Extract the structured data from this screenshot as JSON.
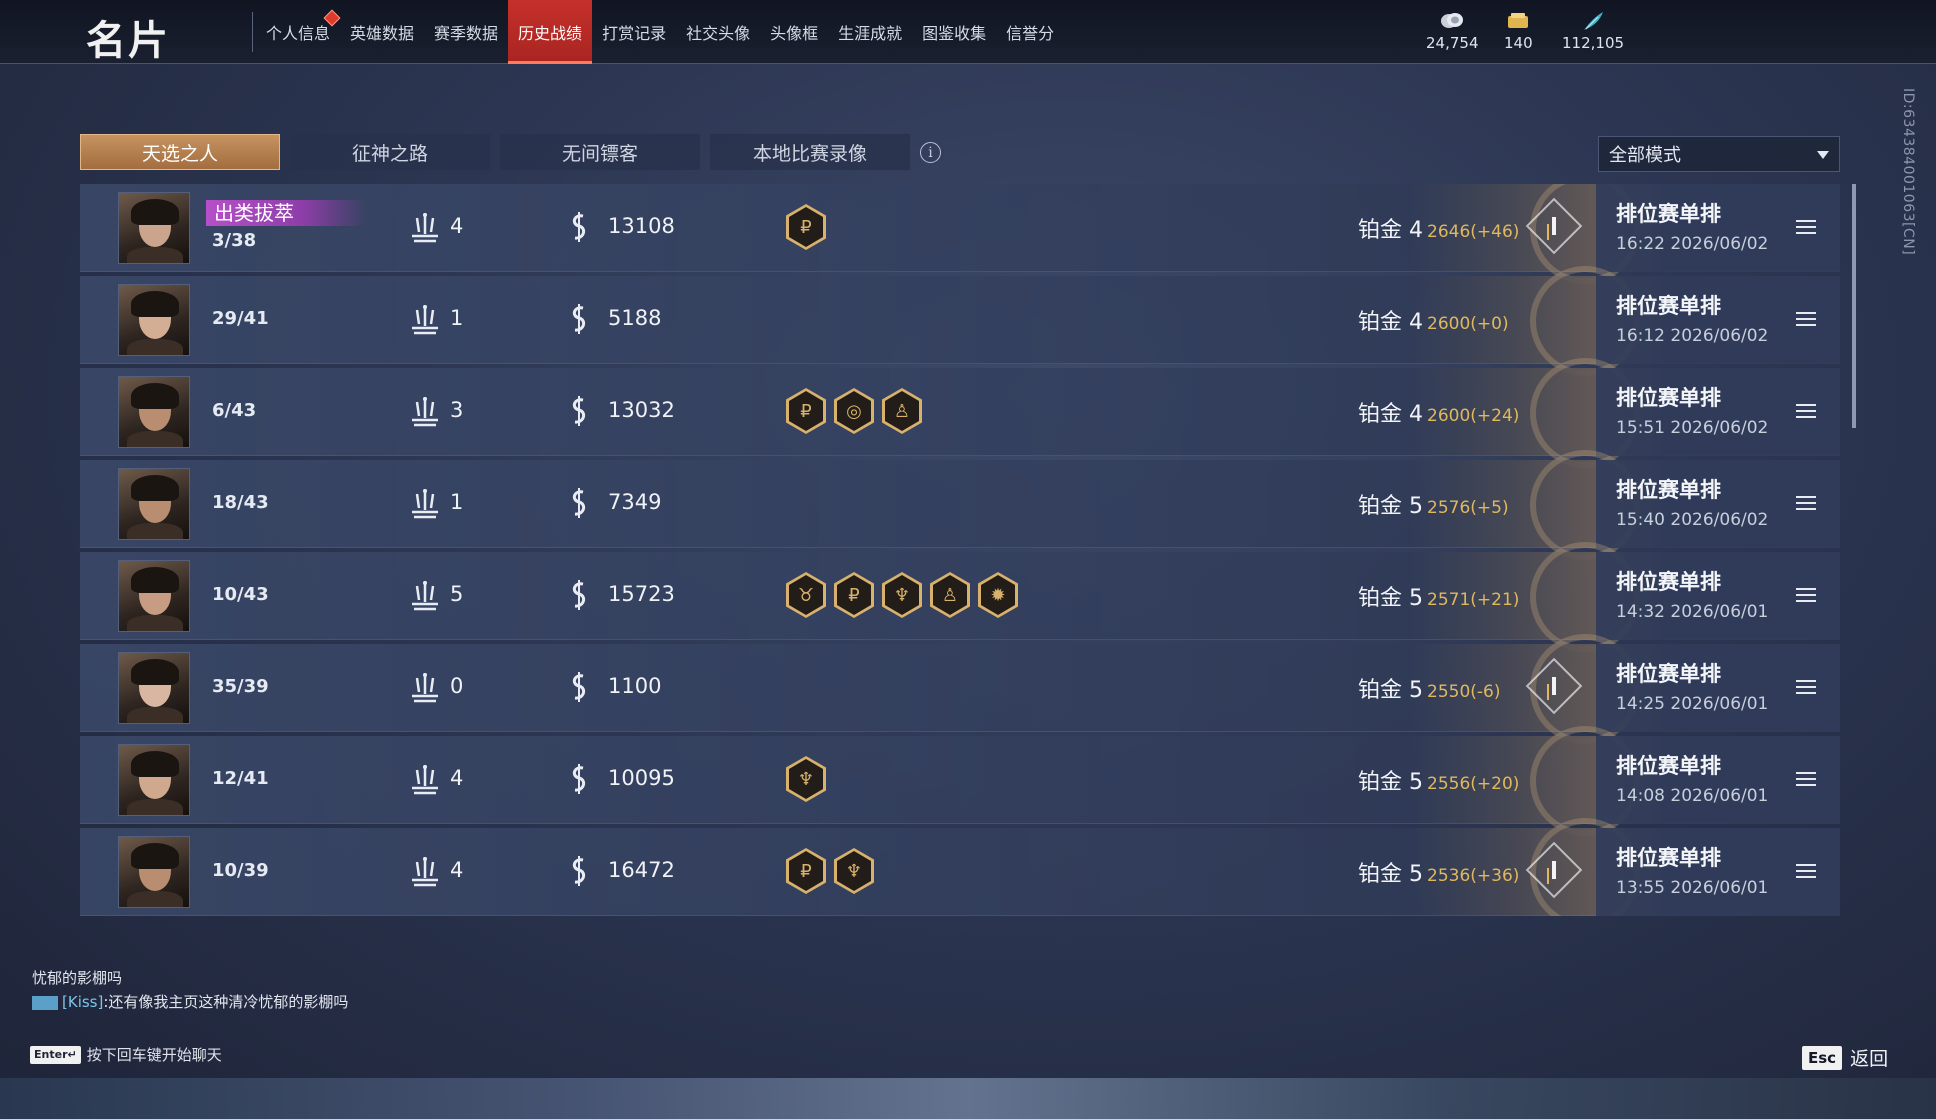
{
  "app_title": "名片",
  "nav_tabs": [
    {
      "label": "个人信息",
      "active": false,
      "badge": true
    },
    {
      "label": "英雄数据",
      "active": false
    },
    {
      "label": "赛季数据",
      "active": false
    },
    {
      "label": "历史战绩",
      "active": true
    },
    {
      "label": "打赏记录",
      "active": false
    },
    {
      "label": "社交头像",
      "active": false
    },
    {
      "label": "头像框",
      "active": false
    },
    {
      "label": "生涯成就",
      "active": false
    },
    {
      "label": "图鉴收集",
      "active": false
    },
    {
      "label": "信誉分",
      "active": false
    }
  ],
  "currencies": [
    {
      "icon": "coin-icon",
      "value": "24,754"
    },
    {
      "icon": "ticket-icon",
      "value": "140"
    },
    {
      "icon": "feather-icon",
      "value": "112,105"
    }
  ],
  "sub_tabs": [
    {
      "label": "天选之人",
      "active": true
    },
    {
      "label": "征神之路",
      "active": false
    },
    {
      "label": "无间镖客",
      "active": false
    },
    {
      "label": "本地比赛录像",
      "active": false
    }
  ],
  "info_glyph": "i",
  "mode_select": {
    "value": "全部模式"
  },
  "side_id": "ID:634384001063[CN]",
  "matches": [
    {
      "title_badge": "出类拔萃",
      "rank": "3/38",
      "kills": "4",
      "currency": "13108",
      "buffs": [
        "₽"
      ],
      "tier": "铂金 4",
      "score": "2646(+46)",
      "up": true,
      "mode": "排位赛单排",
      "time": "16:22  2026/06/02"
    },
    {
      "title_badge": "",
      "rank": "29/41",
      "kills": "1",
      "currency": "5188",
      "buffs": [],
      "tier": "铂金 4",
      "score": "2600(+0)",
      "up": false,
      "mode": "排位赛单排",
      "time": "16:12  2026/06/02"
    },
    {
      "title_badge": "",
      "rank": "6/43",
      "kills": "3",
      "currency": "13032",
      "buffs": [
        "₽",
        "◎",
        "♙"
      ],
      "tier": "铂金 4",
      "score": "2600(+24)",
      "up": false,
      "mode": "排位赛单排",
      "time": "15:51  2026/06/02"
    },
    {
      "title_badge": "",
      "rank": "18/43",
      "kills": "1",
      "currency": "7349",
      "buffs": [],
      "tier": "铂金 5",
      "score": "2576(+5)",
      "up": false,
      "mode": "排位赛单排",
      "time": "15:40  2026/06/02"
    },
    {
      "title_badge": "",
      "rank": "10/43",
      "kills": "5",
      "currency": "15723",
      "buffs": [
        "♉",
        "₽",
        "♆",
        "♙",
        "✹"
      ],
      "tier": "铂金 5",
      "score": "2571(+21)",
      "up": false,
      "mode": "排位赛单排",
      "time": "14:32  2026/06/01"
    },
    {
      "title_badge": "",
      "rank": "35/39",
      "kills": "0",
      "currency": "1100",
      "buffs": [],
      "tier": "铂金 5",
      "score": "2550(-6)",
      "up": true,
      "mode": "排位赛单排",
      "time": "14:25  2026/06/01"
    },
    {
      "title_badge": "",
      "rank": "12/41",
      "kills": "4",
      "currency": "10095",
      "buffs": [
        "♆"
      ],
      "tier": "铂金 5",
      "score": "2556(+20)",
      "up": false,
      "mode": "排位赛单排",
      "time": "14:08  2026/06/01"
    },
    {
      "title_badge": "",
      "rank": "10/39",
      "kills": "4",
      "currency": "16472",
      "buffs": [
        "₽",
        "♆"
      ],
      "tier": "铂金 5",
      "score": "2536(+36)",
      "up": true,
      "mode": "排位赛单排",
      "time": "13:55  2026/06/01"
    }
  ],
  "chat": {
    "line1": "忧郁的影棚吗",
    "sender": "[Kiss]",
    "message": ":还有像我主页这种清冷忧郁的影棚吗",
    "hint": "按下回车键开始聊天",
    "enter_key": "Enter↵"
  },
  "back": {
    "key": "Esc",
    "label": "返回"
  }
}
